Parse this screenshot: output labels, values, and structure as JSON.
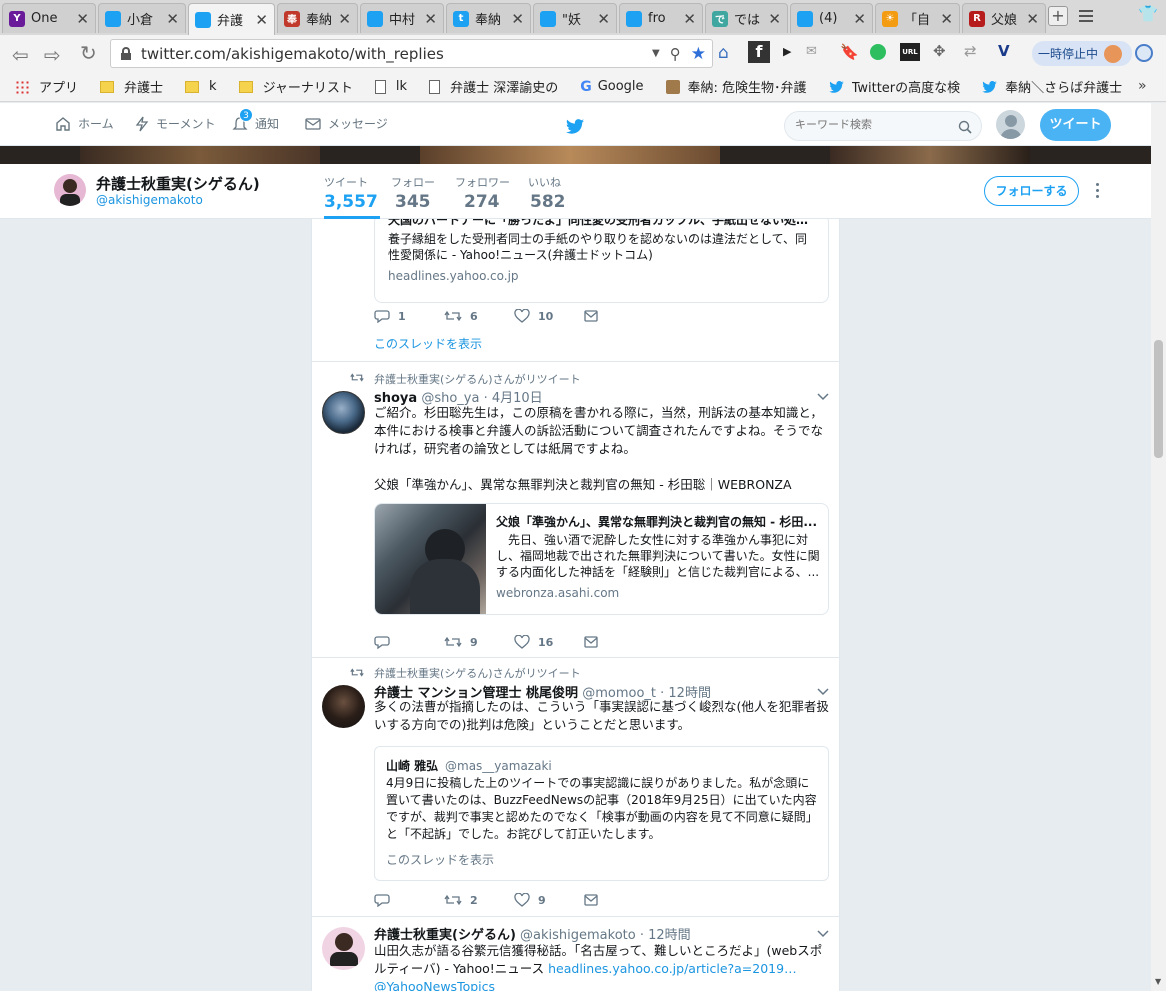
{
  "tabs": [
    {
      "title": "One",
      "color": "#6a1b9a",
      "glyph": "Y"
    },
    {
      "title": "小倉",
      "color": "#1da1f2",
      "glyph": ""
    },
    {
      "title": "弁護",
      "color": "#1da1f2",
      "glyph": "",
      "active": true
    },
    {
      "title": "奉納",
      "color": "#c0392b",
      "glyph": "奉"
    },
    {
      "title": "中村",
      "color": "#1da1f2",
      "glyph": ""
    },
    {
      "title": "奉納",
      "color": "#1da1f2",
      "glyph": "t"
    },
    {
      "title": "\"妖",
      "color": "#1da1f2",
      "glyph": ""
    },
    {
      "title": "fro",
      "color": "#1da1f2",
      "glyph": ""
    },
    {
      "title": "では",
      "color": "#3fa7a0",
      "glyph": "で"
    },
    {
      "title": "(4)",
      "color": "#1da1f2",
      "glyph": ""
    },
    {
      "title": "「自",
      "color": "#f39c12",
      "glyph": "☀"
    },
    {
      "title": "父娘",
      "color": "#b71c1c",
      "glyph": "R"
    }
  ],
  "address": {
    "url": "twitter.com/akishigemakoto/with_replies"
  },
  "toolbar": {
    "pause_label": "一時停止中"
  },
  "bookmarks": [
    {
      "label": "アプリ",
      "kind": "apps"
    },
    {
      "label": "弁護士",
      "kind": "folder"
    },
    {
      "label": "k",
      "kind": "folder"
    },
    {
      "label": "ジャーナリスト",
      "kind": "folder"
    },
    {
      "label": "lk",
      "kind": "doc"
    },
    {
      "label": "弁護士 深澤諭史の",
      "kind": "doc"
    },
    {
      "label": "Google",
      "kind": "google"
    },
    {
      "label": "奉納: 危険生物･弁護",
      "kind": "fav"
    },
    {
      "label": "Twitterの高度な検",
      "kind": "twitter"
    },
    {
      "label": "奉納＼さらば弁護士",
      "kind": "twitter"
    }
  ],
  "nav": {
    "home": "ホーム",
    "moments": "モーメント",
    "notifications": "通知",
    "notif_count": "3",
    "messages": "メッセージ",
    "search_placeholder": "キーワード検索",
    "tweet_button": "ツイート"
  },
  "profile": {
    "name": "弁護士秋重実(シゲるん)",
    "handle": "@akishigemakoto",
    "tweets_label": "ツイート",
    "tweets": "3,557",
    "following_label": "フォロー",
    "following": "345",
    "followers_label": "フォロワー",
    "followers": "274",
    "likes_label": "いいね",
    "likes": "582",
    "follow_button": "フォローする"
  },
  "tweets": [
    {
      "card_title": "天国のパートナーに「勝ったよ」同性愛の受刑者カップル、手紙出せない処分…",
      "card_desc": "養子縁組をした受刑者同士の手紙のやり取りを認めないのは違法だとして、同性愛関係に - Yahoo!ニュース(弁護士ドットコム)",
      "card_domain": "headlines.yahoo.co.jp",
      "replies": "1",
      "retweets": "6",
      "likes": "10",
      "thread_link": "このスレッドを表示"
    },
    {
      "rt_label": "弁護士秋重実(シゲるん)さんがリツイート",
      "name": "shoya",
      "handle": "@sho_ya",
      "time": "· 4月10日",
      "text": "ご紹介。杉田聡先生は，この原稿を書かれる際に，当然，刑訴法の基本知識と，本件における検事と弁護人の訴訟活動について調査されたんですよね。そうでなければ，研究者の論攷としては紙屑ですよね。",
      "text2": "父娘「準強かん」、異常な無罪判決と裁判官の無知 - 杉田聡｜WEBRONZA",
      "card_title": "父娘「準強かん」、異常な無罪判決と裁判官の無知 - 杉田...",
      "card_desc": "先日、強い酒で泥酔した女性に対する準強かん事犯に対し、福岡地裁で出された無罪判決について書いた。女性に関する内面化した神話を「経験則」と信じた裁判官による、...",
      "card_domain": "webronza.asahi.com",
      "replies": "",
      "retweets": "9",
      "likes": "16"
    },
    {
      "rt_label": "弁護士秋重実(シゲるん)さんがリツイート",
      "name": "弁護士 マンション管理士 桃尾俊明",
      "handle": "@momoo_t",
      "time": "· 12時間",
      "text": "多くの法曹が指摘したのは、こういう「事実誤認に基づく峻烈な(他人を犯罪者扱いする方向での)批判は危険」ということだと思います。",
      "quote_name": "山崎 雅弘",
      "quote_handle": "@mas__yamazaki",
      "quote_text": "4月9日に投稿した上のツイートでの事実認識に誤りがありました。私が念頭に置いて書いたのは、BuzzFeedNewsの記事（2018年9月25日）に出ていた内容ですが、裁判で事実と認めたのでなく「検事が動画の内容を見て不同意に疑問」と「不起訴」でした。お詫びして訂正いたします。",
      "quote_thread": "このスレッドを表示",
      "replies": "",
      "retweets": "2",
      "likes": "9"
    },
    {
      "name": "弁護士秋重実(シゲるん)",
      "handle": "@akishigemakoto",
      "time": "· 12時間",
      "text": "山田久志が語る谷繁元信獲得秘話。「名古屋って、難しいところだよ」(webスポルティーバ) - Yahoo!ニュース",
      "link": "headlines.yahoo.co.jp/article?a=2019…",
      "mention": "@YahooNewsTopics"
    }
  ]
}
